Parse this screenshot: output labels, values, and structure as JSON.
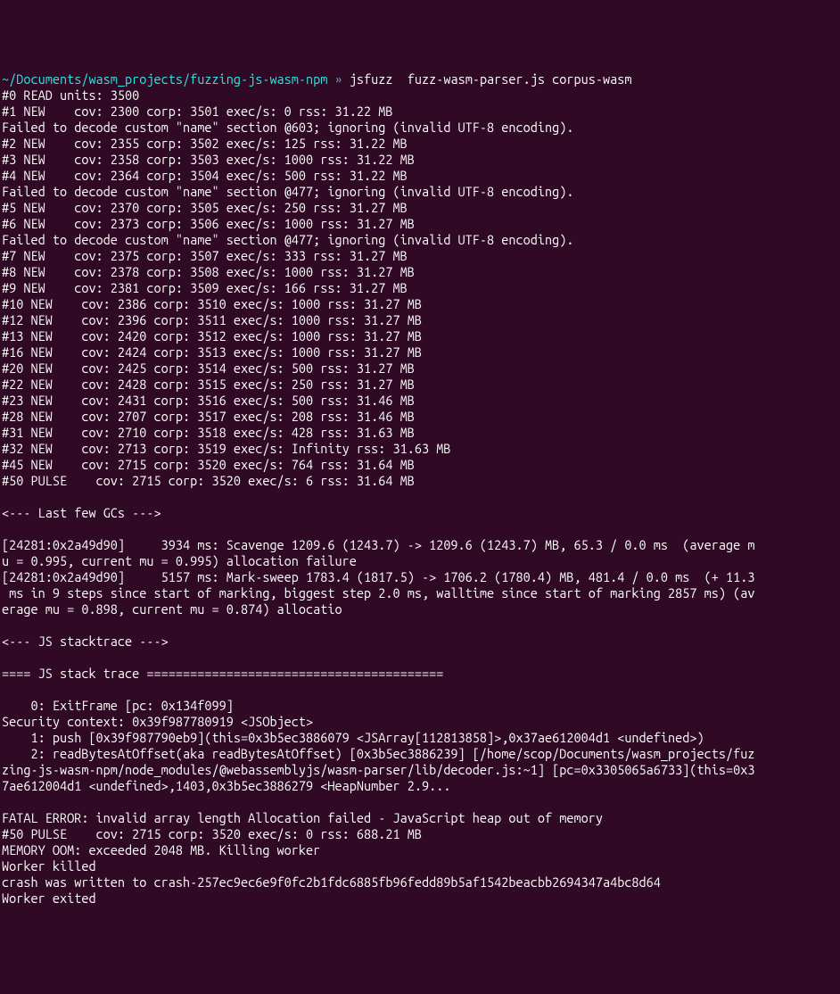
{
  "prompt": {
    "path": "~/Documents/wasm_projects/fuzzing-js-wasm-npm",
    "separator": " » ",
    "command": "jsfuzz  fuzz-wasm-parser.js corpus-wasm"
  },
  "lines": [
    "#0 READ units: 3500",
    "#1 NEW    cov: 2300 corp: 3501 exec/s: 0 rss: 31.22 MB",
    "Failed to decode custom \"name\" section @603; ignoring (invalid UTF-8 encoding).",
    "#2 NEW    cov: 2355 corp: 3502 exec/s: 125 rss: 31.22 MB",
    "#3 NEW    cov: 2358 corp: 3503 exec/s: 1000 rss: 31.22 MB",
    "#4 NEW    cov: 2364 corp: 3504 exec/s: 500 rss: 31.22 MB",
    "Failed to decode custom \"name\" section @477; ignoring (invalid UTF-8 encoding).",
    "#5 NEW    cov: 2370 corp: 3505 exec/s: 250 rss: 31.27 MB",
    "#6 NEW    cov: 2373 corp: 3506 exec/s: 1000 rss: 31.27 MB",
    "Failed to decode custom \"name\" section @477; ignoring (invalid UTF-8 encoding).",
    "#7 NEW    cov: 2375 corp: 3507 exec/s: 333 rss: 31.27 MB",
    "#8 NEW    cov: 2378 corp: 3508 exec/s: 1000 rss: 31.27 MB",
    "#9 NEW    cov: 2381 corp: 3509 exec/s: 166 rss: 31.27 MB",
    "#10 NEW    cov: 2386 corp: 3510 exec/s: 1000 rss: 31.27 MB",
    "#12 NEW    cov: 2396 corp: 3511 exec/s: 1000 rss: 31.27 MB",
    "#13 NEW    cov: 2420 corp: 3512 exec/s: 1000 rss: 31.27 MB",
    "#16 NEW    cov: 2424 corp: 3513 exec/s: 1000 rss: 31.27 MB",
    "#20 NEW    cov: 2425 corp: 3514 exec/s: 500 rss: 31.27 MB",
    "#22 NEW    cov: 2428 corp: 3515 exec/s: 250 rss: 31.27 MB",
    "#23 NEW    cov: 2431 corp: 3516 exec/s: 500 rss: 31.46 MB",
    "#28 NEW    cov: 2707 corp: 3517 exec/s: 208 rss: 31.46 MB",
    "#31 NEW    cov: 2710 corp: 3518 exec/s: 428 rss: 31.63 MB",
    "#32 NEW    cov: 2713 corp: 3519 exec/s: Infinity rss: 31.63 MB",
    "#45 NEW    cov: 2715 corp: 3520 exec/s: 764 rss: 31.64 MB",
    "#50 PULSE    cov: 2715 corp: 3520 exec/s: 6 rss: 31.64 MB",
    "",
    "<--- Last few GCs --->",
    "",
    "[24281:0x2a49d90]     3934 ms: Scavenge 1209.6 (1243.7) -> 1209.6 (1243.7) MB, 65.3 / 0.0 ms  (average mu = 0.995, current mu = 0.995) allocation failure ",
    "[24281:0x2a49d90]     5157 ms: Mark-sweep 1783.4 (1817.5) -> 1706.2 (1780.4) MB, 481.4 / 0.0 ms  (+ 11.3 ms in 9 steps since start of marking, biggest step 2.0 ms, walltime since start of marking 2857 ms) (average mu = 0.898, current mu = 0.874) allocatio",
    "",
    "<--- JS stacktrace --->",
    "",
    "==== JS stack trace =========================================",
    "",
    "    0: ExitFrame [pc: 0x134f099]",
    "Security context: 0x39f987780919 <JSObject>",
    "    1: push [0x39f987790eb9](this=0x3b5ec3886079 <JSArray[112813858]>,0x37ae612004d1 <undefined>)",
    "    2: readBytesAtOffset(aka readBytesAtOffset) [0x3b5ec3886239] [/home/scop/Documents/wasm_projects/fuzzing-js-wasm-npm/node_modules/@webassemblyjs/wasm-parser/lib/decoder.js:~1] [pc=0x3305065a6733](this=0x37ae612004d1 <undefined>,1403,0x3b5ec3886279 <HeapNumber 2.9...",
    "",
    "FATAL ERROR: invalid array length Allocation failed - JavaScript heap out of memory",
    "#50 PULSE    cov: 2715 corp: 3520 exec/s: 0 rss: 688.21 MB",
    "MEMORY OOM: exceeded 2048 MB. Killing worker",
    "Worker killed",
    "crash was written to crash-257ec9ec6e9f0fc2b1fdc6885fb96fedd89b5af1542beacbb2694347a4bc8d64",
    "Worker exited"
  ]
}
